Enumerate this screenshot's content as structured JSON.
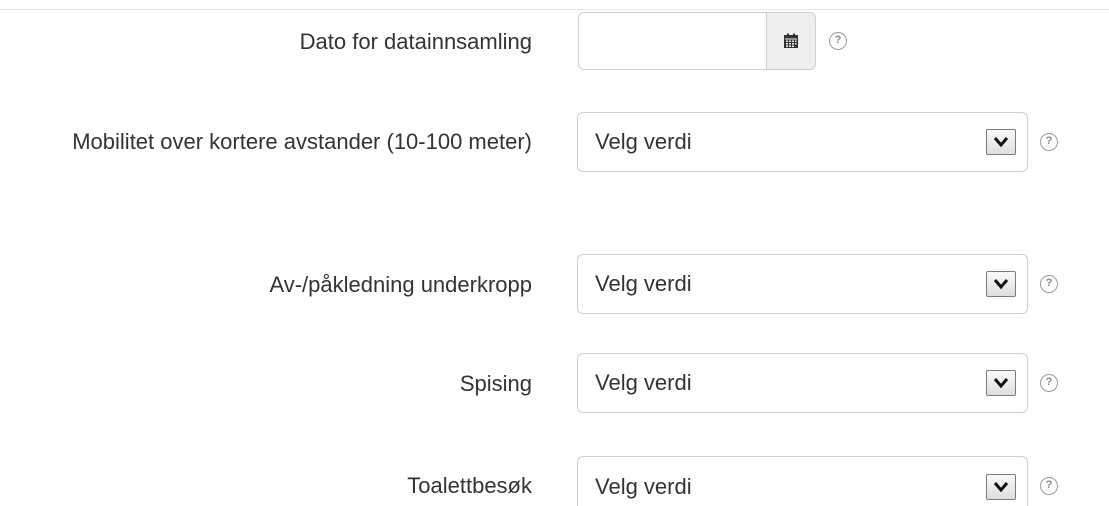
{
  "form": {
    "fields": [
      {
        "label": "Dato for datainnsamling",
        "type": "date",
        "value": "",
        "help": "?"
      },
      {
        "label": "Mobilitet over kortere avstander (10-100 meter)",
        "type": "select",
        "value": "Velg verdi",
        "help": "?"
      },
      {
        "label": "Av-/påkledning underkropp",
        "type": "select",
        "value": "Velg verdi",
        "help": "?"
      },
      {
        "label": "Spising",
        "type": "select",
        "value": "Velg verdi",
        "help": "?"
      },
      {
        "label": "Toalettbesøk",
        "type": "select",
        "value": "Velg verdi",
        "help": "?"
      }
    ]
  },
  "icons": {
    "date_button": "calendar-icon",
    "select_arrow": "chevron-down-icon",
    "help": "question-circle-icon"
  },
  "colors": {
    "border": "#cfcfcf",
    "text": "#333333",
    "addon_bg": "#efefef",
    "help_icon": "#9a9a9a"
  }
}
